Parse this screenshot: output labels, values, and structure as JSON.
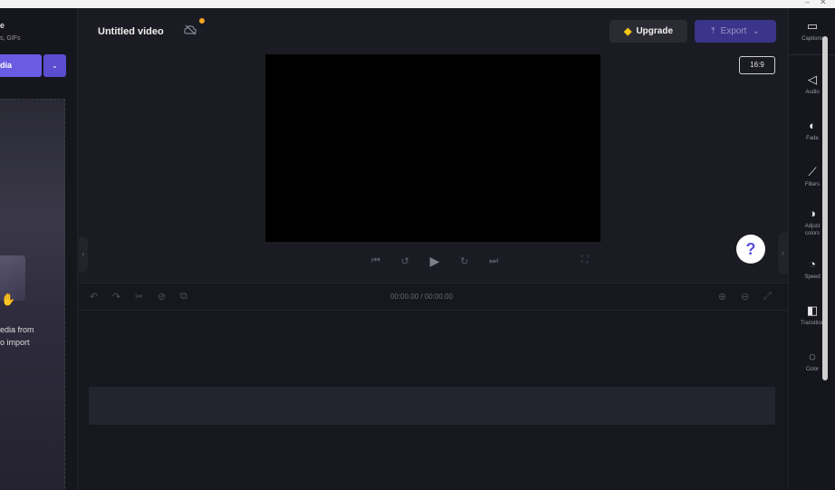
{
  "window": {
    "controls": [
      "–",
      "✕"
    ]
  },
  "left_panel": {
    "title": "e",
    "subtitle": "s, GIFs",
    "import_label": "dia",
    "drop_text": "edia from\no import"
  },
  "header": {
    "title": "Untitled video",
    "upgrade_label": "Upgrade",
    "export_label": "Export"
  },
  "preview": {
    "aspect_ratio": "16:9",
    "help": "?"
  },
  "timeline": {
    "timecode": "00:00.00 / 00:00.00"
  },
  "right_rail": {
    "items": [
      {
        "label": "Captions",
        "icon": "▭"
      },
      {
        "label": "Audio",
        "icon": "◁"
      },
      {
        "label": "Fade",
        "icon": "◐"
      },
      {
        "label": "Filters",
        "icon": "⟋"
      },
      {
        "label": "Adjust colors",
        "icon": "◑"
      },
      {
        "label": "Speed",
        "icon": "◔"
      },
      {
        "label": "Transition",
        "icon": "◧"
      },
      {
        "label": "Color",
        "icon": "◌"
      }
    ]
  },
  "colors": {
    "accent": "#6a5be3",
    "background": "#1b1b23",
    "preview": "#000000"
  }
}
